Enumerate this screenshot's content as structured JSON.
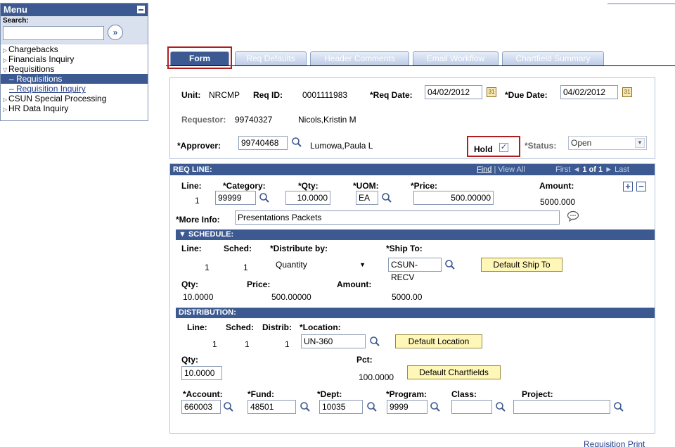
{
  "menu": {
    "title": "Menu",
    "search_label": "Search:",
    "go_glyph": "»",
    "items": [
      {
        "label": "Chargebacks"
      },
      {
        "label": "Financials Inquiry"
      },
      {
        "label": "Requisitions"
      },
      {
        "label": "CSUN Special Processing"
      },
      {
        "label": "HR Data Inquiry"
      }
    ],
    "sub_items": [
      {
        "label": "Requisitions"
      },
      {
        "label": "Requisition Inquiry"
      }
    ]
  },
  "tabs": [
    {
      "label": "Form"
    },
    {
      "label": "Req Defaults"
    },
    {
      "label": "Header Comments"
    },
    {
      "label": "Email Workflow"
    },
    {
      "label": "Chartfield Summary"
    }
  ],
  "header": {
    "unit_label": "Unit:",
    "unit_value": "NRCMP",
    "reqid_label": "Req ID:",
    "reqid_value": "0001111983",
    "reqdate_label": "*Req Date:",
    "reqdate_value": "04/02/2012",
    "duedate_label": "*Due Date:",
    "duedate_value": "04/02/2012",
    "calendar_glyph": "31",
    "requestor_label": "Requestor:",
    "requestor_id": "99740327",
    "requestor_name": "Nicols,Kristin M",
    "approver_label": "*Approver:",
    "approver_id": "99740468",
    "approver_name": "Lumowa,Paula L",
    "hold_label": "Hold",
    "hold_checked": "✓",
    "status_label": "*Status:",
    "status_value": "Open"
  },
  "req_line": {
    "title": "REQ LINE:",
    "nav_find": "Find",
    "nav_viewall": "View All",
    "nav_first": "First",
    "nav_count": "1 of 1",
    "nav_last": "Last",
    "line_label": "Line:",
    "line_value": "1",
    "category_label": "*Category:",
    "category_value": "99999",
    "qty_label": "*Qty:",
    "qty_value": "10.0000",
    "uom_label": "*UOM:",
    "uom_value": "EA",
    "price_label": "*Price:",
    "price_value": "500.00000",
    "amount_label": "Amount:",
    "amount_value": "5000.000",
    "moreinfo_label": "*More Info:",
    "moreinfo_value": "Presentations Packets",
    "add_glyph": "+",
    "remove_glyph": "−"
  },
  "schedule": {
    "title": "SCHEDULE:",
    "line_label": "Line:",
    "line_value": "1",
    "sched_label": "Sched:",
    "sched_value": "1",
    "distribute_label": "*Distribute by:",
    "distribute_value": "Quantity",
    "shipto_label": "*Ship To:",
    "shipto_value": "CSUN-RECV",
    "default_shipto": "Default Ship To",
    "qty_label": "Qty:",
    "qty_value": "10.0000",
    "price_label": "Price:",
    "price_value": "500.00000",
    "amount_label": "Amount:",
    "amount_value": "5000.00"
  },
  "distribution": {
    "title": "DISTRIBUTION:",
    "line_label": "Line:",
    "line_value": "1",
    "sched_label": "Sched:",
    "sched_value": "1",
    "distrib_label": "Distrib:",
    "distrib_value": "1",
    "location_label": "*Location:",
    "location_value": "UN-360",
    "default_location": "Default Location",
    "qty_label": "Qty:",
    "qty_value": "10.0000",
    "pct_label": "Pct:",
    "pct_value": "100.0000",
    "default_chartfields": "Default Chartfields",
    "account_label": "*Account:",
    "account_value": "660003",
    "fund_label": "*Fund:",
    "fund_value": "48501",
    "dept_label": "*Dept:",
    "dept_value": "10035",
    "program_label": "*Program:",
    "program_value": "9999",
    "class_label": "Class:",
    "class_value": "",
    "project_label": "Project:",
    "project_value": ""
  },
  "footer": {
    "requisition_print": "Requisition Print"
  },
  "colors": {
    "header_blue": "#3c5a91",
    "highlight_red": "#b11d1d",
    "button_yellow": "#fff7b8"
  }
}
